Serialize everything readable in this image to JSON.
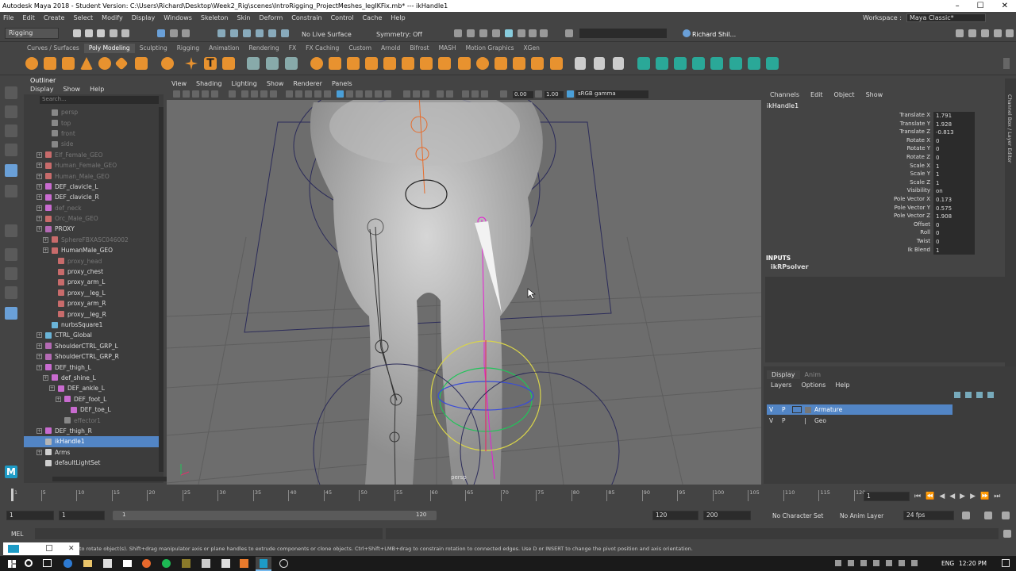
{
  "window": {
    "title": "Autodesk Maya 2018 - Student Version: C:\\Users\\Richard\\Desktop\\Week2_Rig\\scenes\\IntroRigging_ProjectMeshes_legIKFix.mb*  ---  ikHandle1",
    "minimize": "–",
    "maximize": "☐",
    "close": "✕"
  },
  "menubar": {
    "items": [
      "File",
      "Edit",
      "Create",
      "Select",
      "Modify",
      "Display",
      "Windows",
      "Skeleton",
      "Skin",
      "Deform",
      "Constrain",
      "Control",
      "Cache",
      "Help"
    ],
    "workspace_label": "Workspace :",
    "workspace_value": "Maya Classic*"
  },
  "status": {
    "menuset": "Rigging",
    "live_surface": "No Live Surface",
    "symmetry": "Symmetry: Off",
    "user": "Richard Shil..."
  },
  "shelf_tabs": [
    "Curves / Surfaces",
    "Poly Modeling",
    "Sculpting",
    "Rigging",
    "Animation",
    "Rendering",
    "FX",
    "FX Caching",
    "Custom",
    "Arnold",
    "Bifrost",
    "MASH",
    "Motion Graphics",
    "XGen"
  ],
  "shelf_active": "Poly Modeling",
  "outliner": {
    "title": "Outliner",
    "menu": [
      "Display",
      "Show",
      "Help"
    ],
    "search_placeholder": "Search...",
    "items": [
      {
        "label": "persp",
        "indent": 1,
        "dim": true,
        "icon": "camera-icon",
        "expand": false
      },
      {
        "label": "top",
        "indent": 1,
        "dim": true,
        "icon": "camera-icon",
        "expand": false
      },
      {
        "label": "front",
        "indent": 1,
        "dim": true,
        "icon": "camera-icon",
        "expand": false
      },
      {
        "label": "side",
        "indent": 1,
        "dim": true,
        "icon": "camera-icon",
        "expand": false
      },
      {
        "label": "Elf_Female_GEO",
        "indent": 0,
        "dim": true,
        "icon": "mesh-icon",
        "expand": true
      },
      {
        "label": "Human_Female_GEO",
        "indent": 0,
        "dim": true,
        "icon": "mesh-icon",
        "expand": true
      },
      {
        "label": "Human_Male_GEO",
        "indent": 0,
        "dim": true,
        "icon": "mesh-icon",
        "expand": true
      },
      {
        "label": "DEF_clavicle_L",
        "indent": 0,
        "dim": false,
        "icon": "joint-icon",
        "expand": true
      },
      {
        "label": "DEF_clavicle_R",
        "indent": 0,
        "dim": false,
        "icon": "joint-icon",
        "expand": true
      },
      {
        "label": "def_neck",
        "indent": 0,
        "dim": true,
        "icon": "joint-icon",
        "expand": true
      },
      {
        "label": "Orc_Male_GEO",
        "indent": 0,
        "dim": true,
        "icon": "mesh-icon",
        "expand": true
      },
      {
        "label": "PROXY",
        "indent": 0,
        "dim": false,
        "icon": "group-icon",
        "expand": true
      },
      {
        "label": "SphereFBXASC046002",
        "indent": 1,
        "dim": true,
        "icon": "mesh-icon",
        "expand": true
      },
      {
        "label": "HumanMale_GEO",
        "indent": 1,
        "dim": false,
        "icon": "mesh-icon",
        "expand": true
      },
      {
        "label": "proxy_head",
        "indent": 2,
        "dim": true,
        "icon": "mesh-icon",
        "expand": false
      },
      {
        "label": "proxy_chest",
        "indent": 2,
        "dim": false,
        "icon": "mesh-icon",
        "expand": false
      },
      {
        "label": "proxy_arm_L",
        "indent": 2,
        "dim": false,
        "icon": "mesh-icon",
        "expand": false
      },
      {
        "label": "proxy__leg_L",
        "indent": 2,
        "dim": false,
        "icon": "mesh-icon",
        "expand": false
      },
      {
        "label": "proxy_arm_R",
        "indent": 2,
        "dim": false,
        "icon": "mesh-icon",
        "expand": false
      },
      {
        "label": "proxy__leg_R",
        "indent": 2,
        "dim": false,
        "icon": "mesh-icon",
        "expand": false
      },
      {
        "label": "nurbsSquare1",
        "indent": 1,
        "dim": false,
        "icon": "curve-icon",
        "expand": false
      },
      {
        "label": "CTRL_Global",
        "indent": 0,
        "dim": false,
        "icon": "curve-icon",
        "expand": true
      },
      {
        "label": "ShoulderCTRL_GRP_L",
        "indent": 0,
        "dim": false,
        "icon": "group-icon",
        "expand": true
      },
      {
        "label": "ShoulderCTRL_GRP_R",
        "indent": 0,
        "dim": false,
        "icon": "group-icon",
        "expand": true
      },
      {
        "label": "DEF_thigh_L",
        "indent": 0,
        "dim": false,
        "icon": "joint-icon",
        "expand": true
      },
      {
        "label": "def_shine_L",
        "indent": 1,
        "dim": false,
        "icon": "joint-icon",
        "expand": true
      },
      {
        "label": "DEF_ankle_L",
        "indent": 2,
        "dim": false,
        "icon": "joint-icon",
        "expand": true
      },
      {
        "label": "DEF_foot_L",
        "indent": 3,
        "dim": false,
        "icon": "joint-icon",
        "expand": true
      },
      {
        "label": "DEF_toe_L",
        "indent": 4,
        "dim": false,
        "icon": "joint-icon",
        "expand": false
      },
      {
        "label": "effector1",
        "indent": 3,
        "dim": true,
        "icon": "effector-icon",
        "expand": false
      },
      {
        "label": "DEF_thigh_R",
        "indent": 0,
        "dim": false,
        "icon": "joint-icon",
        "expand": true
      },
      {
        "label": "ikHandle1",
        "indent": 0,
        "dim": false,
        "icon": "ikhandle-icon",
        "expand": false,
        "selected": true
      },
      {
        "label": "Arms",
        "indent": 0,
        "dim": false,
        "icon": "set-icon",
        "expand": true
      },
      {
        "label": "defaultLightSet",
        "indent": 0,
        "dim": false,
        "icon": "set-icon",
        "expand": false
      }
    ]
  },
  "viewport": {
    "menu": [
      "View",
      "Shading",
      "Lighting",
      "Show",
      "Renderer",
      "Panels"
    ],
    "near": "0.00",
    "far": "1.00",
    "color_space": "sRGB gamma",
    "camera_label": "persp"
  },
  "channel_box": {
    "menu": [
      "Channels",
      "Edit",
      "Object",
      "Show"
    ],
    "object": "ikHandle1",
    "channels": [
      {
        "name": "Translate X",
        "value": "1.791"
      },
      {
        "name": "Translate Y",
        "value": "1.928"
      },
      {
        "name": "Translate Z",
        "value": "-0.813"
      },
      {
        "name": "Rotate X",
        "value": "0"
      },
      {
        "name": "Rotate Y",
        "value": "0"
      },
      {
        "name": "Rotate Z",
        "value": "0"
      },
      {
        "name": "Scale X",
        "value": "1"
      },
      {
        "name": "Scale Y",
        "value": "1"
      },
      {
        "name": "Scale Z",
        "value": "1"
      },
      {
        "name": "Visibility",
        "value": "on"
      },
      {
        "name": "Pole Vector X",
        "value": "0.173"
      },
      {
        "name": "Pole Vector Y",
        "value": "0.575"
      },
      {
        "name": "Pole Vector Z",
        "value": "1.908"
      },
      {
        "name": "Offset",
        "value": "0"
      },
      {
        "name": "Roll",
        "value": "0"
      },
      {
        "name": "Twist",
        "value": "0"
      },
      {
        "name": "Ik Blend",
        "value": "1"
      }
    ],
    "inputs_label": "INPUTS",
    "solver": "ikRPsolver"
  },
  "side_tabs": "Channel Box / Layer Editor",
  "layers": {
    "tabs": [
      "Display",
      "Anim"
    ],
    "menu": [
      "Layers",
      "Options",
      "Help"
    ],
    "rows": [
      {
        "v": "V",
        "p": "P",
        "name": "Armature",
        "selected": true
      },
      {
        "v": "V",
        "p": "P",
        "name": "Geo",
        "selected": false
      }
    ]
  },
  "timeline": {
    "ticks": [
      "1",
      "5",
      "10",
      "15",
      "20",
      "25",
      "30",
      "35",
      "40",
      "45",
      "50",
      "55",
      "60",
      "65",
      "70",
      "75",
      "80",
      "85",
      "90",
      "95",
      "100",
      "105",
      "110",
      "115",
      "120"
    ],
    "current_frame": "1",
    "range_start": "1",
    "range_inner_start": "1",
    "range_slider_start": "1",
    "range_slider_end": "120",
    "range_inner_end": "120",
    "range_end": "200",
    "character_set": "No Character Set",
    "anim_layer": "No Anim Layer",
    "fps": "24 fps"
  },
  "mel": {
    "label": "MEL"
  },
  "helpline": "to rotate object(s). Shift+drag manipulator axis or plane handles to extrude components or clone objects. Ctrl+Shift+LMB+drag to constrain rotation to connected edges. Use D or INSERT to change the pivot position and axis orientation.",
  "taskbar": {
    "lang": "ENG",
    "time": "12:20 PM"
  }
}
